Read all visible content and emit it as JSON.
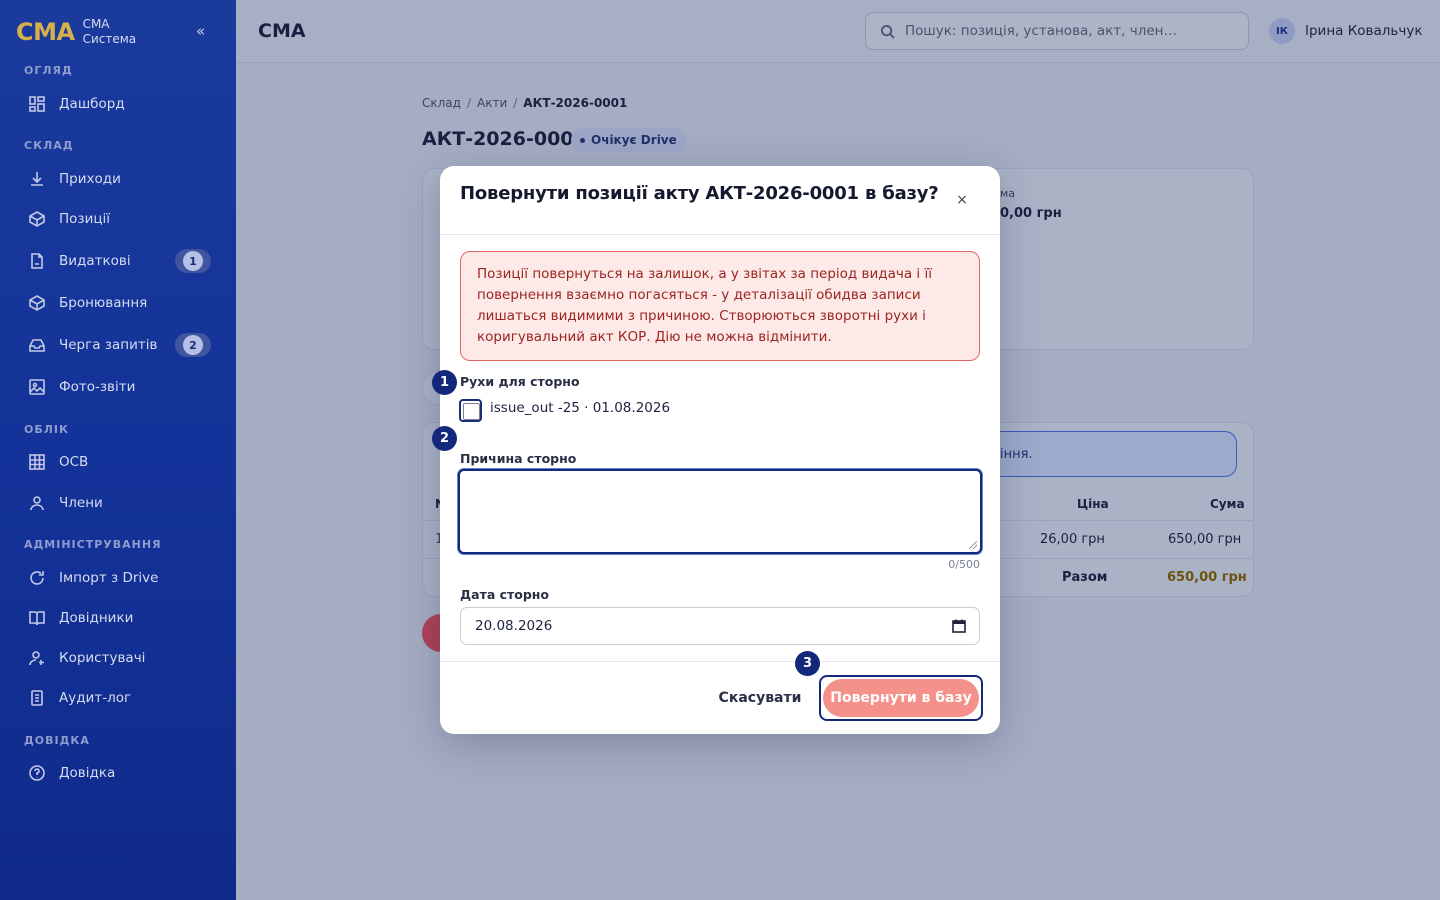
{
  "sidebar": {
    "brand_logo": "СМА",
    "brand_line1": "СМА",
    "brand_line2": "Система",
    "collapse_label": "«",
    "sections": {
      "overview": "ОГЛЯД",
      "warehouse": "СКЛАД",
      "accounting": "ОБЛІК",
      "admin": "АДМІНІСТРУВАННЯ",
      "help": "ДОВІДКА"
    },
    "items": {
      "dashboard": "Дашборд",
      "receipts": "Приходи",
      "positions": "Позиції",
      "issues": "Видаткові",
      "issues_badge": "1",
      "bookings": "Бронювання",
      "queue": "Черга запитів",
      "queue_badge": "2",
      "photo_reports": "Фото-звіти",
      "osv": "ОСВ",
      "members": "Члени",
      "import_drive": "Імпорт з Drive",
      "directories": "Довідники",
      "users": "Користувачі",
      "audit_log": "Аудит-лог",
      "help": "Довідка"
    }
  },
  "header": {
    "title": "СМА",
    "search_placeholder": "Пошук: позиція, установа, акт, член…",
    "user_initials": "ІК",
    "user_name": "Ірина Ковальчук"
  },
  "page": {
    "breadcrumb": [
      "Склад",
      "Акти",
      "АКТ-2026-0001"
    ],
    "title": "АКТ-2026-0001",
    "status": "Очікує Drive",
    "bg_sum_label": "ма",
    "bg_sum_value": "0,00 грн",
    "bg_info_tail": "іння.",
    "bg_col_price": "Ціна",
    "bg_col_sum": "Сума",
    "bg_row_price": "26,00 грн",
    "bg_row_sum": "650,00 грн",
    "bg_total_label": "Разом",
    "bg_total_value": "650,00 грн",
    "bg_col_n": "N",
    "bg_row_n": "1"
  },
  "modal": {
    "title": "Повернути позиції акту АКТ-2026-0001 в базу?",
    "close": "×",
    "alert": "Позиції повернуться на залишок, а у звітах за період видача і її повернення взаємно погасяться - у деталізації обидва записи лишаться видимими з причиною. Створюються зворотні рухи і коригувальний акт КОР. Дію не можна відмінити.",
    "movements_label": "Рухи для сторно",
    "movement_item": "issue_out -25 · 01.08.2026",
    "reason_label": "Причина сторно",
    "reason_value": "",
    "counter": "0/500",
    "date_label": "Дата сторно",
    "date_value": "20.08.2026",
    "cancel": "Скасувати",
    "confirm": "Повернути в базу"
  },
  "markers": [
    "1",
    "2",
    "3"
  ]
}
